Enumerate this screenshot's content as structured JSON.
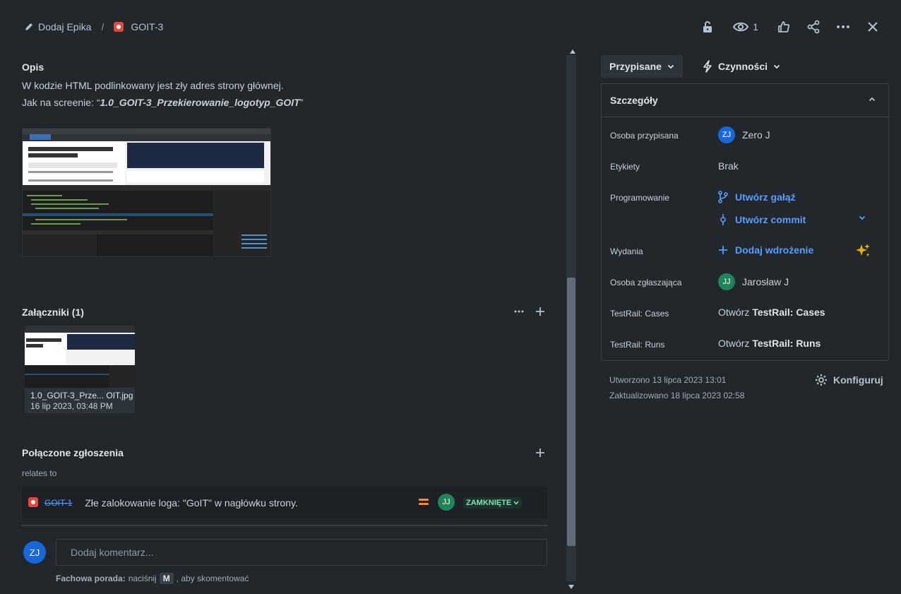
{
  "header": {
    "epic_label": "Dodaj Epika",
    "separator": "/",
    "issue_key": "GOIT-3",
    "watchers_count": "1"
  },
  "description": {
    "title": "Opis",
    "line1": "W kodzie HTML podlinkowany jest zły adres strony głównej.",
    "line2_prefix": "Jak na screenie: “",
    "line2_bold": "1.0_GOIT-3_Przekierowanie_logotyp_GOIT",
    "line2_suffix": "”"
  },
  "attachments": {
    "title": "Załączniki (1)",
    "items": [
      {
        "name": "1.0_GOIT-3_Prze... OIT.jpg",
        "date": "16 lip 2023, 03:48 PM"
      }
    ]
  },
  "linked": {
    "title": "Połączone zgłoszenia",
    "relation": "relates to",
    "items": [
      {
        "key": "GOIT-1",
        "summary": "Złe zalokowanie loga: \"GoIT\" w nagłówku strony.",
        "assignee_initials": "JJ",
        "status": "ZAMKNIĘTE"
      }
    ]
  },
  "comment": {
    "avatar": "ZJ",
    "placeholder": "Dodaj komentarz...",
    "tip_bold": "Fachowa porada:",
    "tip_text1": "naciśnij",
    "tip_key": "M",
    "tip_text2": ", aby skomentować"
  },
  "sidebar": {
    "status_label": "Przypisane",
    "actions_label": "Czynności",
    "details_title": "Szczegóły",
    "fields": {
      "assignee_label": "Osoba przypisana",
      "assignee_initials": "ZJ",
      "assignee_name": "Zero J",
      "labels_label": "Etykiety",
      "labels_value": "Brak",
      "dev_label": "Programowanie",
      "create_branch": "Utwórz gałąź",
      "create_commit": "Utwórz commit",
      "releases_label": "Wydania",
      "add_deployment": "Dodaj wdrożenie",
      "reporter_label": "Osoba zgłaszająca",
      "reporter_initials": "JJ",
      "reporter_name": "Jarosław J",
      "testrail_cases_label": "TestRail: Cases",
      "testrail_cases_prefix": "Otwórz",
      "testrail_cases_bold": "TestRail: Cases",
      "testrail_runs_label": "TestRail: Runs",
      "testrail_runs_prefix": "Otwórz",
      "testrail_runs_bold": "TestRail: Runs"
    },
    "created": "Utworzono 13 lipca 2023 13:01",
    "updated": "Zaktualizowano 18 lipca 2023 02:58",
    "configure": "Konfiguruj"
  },
  "colors": {
    "background": "#22272b",
    "link": "#579dff",
    "bug_red": "#e2483d",
    "status_green": "#7ee2b8",
    "avatar_blue": "#1868db",
    "avatar_green": "#1f845a",
    "ai_gold": "#e2b203"
  }
}
